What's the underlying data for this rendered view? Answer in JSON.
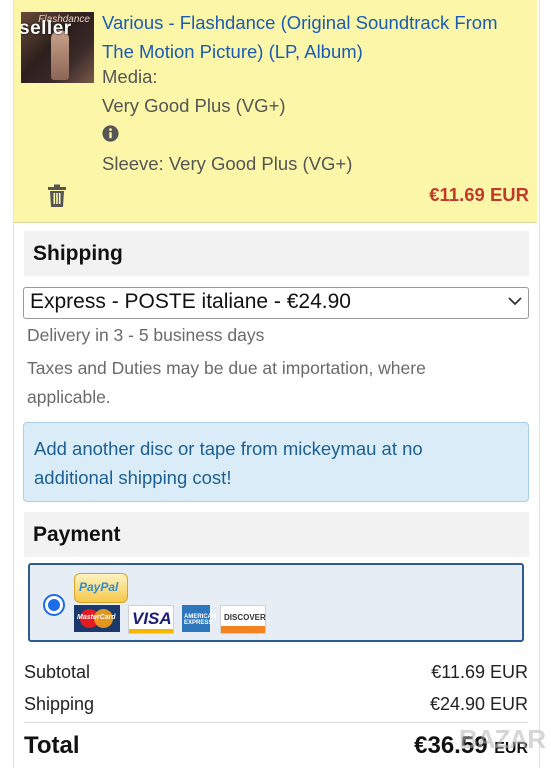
{
  "item": {
    "thumbnail_text": "seller",
    "thumbnail_script": "Flashdance",
    "title": "Various - Flashdance (Original Soundtrack From The Motion Picture) (LP, Album)",
    "media_label": "Media:",
    "media_value": "Very Good Plus (VG+)",
    "sleeve": "Sleeve: Very Good Plus (VG+)",
    "price": "€11.69 EUR",
    "icons": [
      "info-icon",
      "trash-icon"
    ]
  },
  "shipping": {
    "heading": "Shipping",
    "selected_option": "Express - POSTE italiane - €24.90",
    "delivery": "Delivery in 3 - 5 business days",
    "taxes_note": "Taxes and Duties may be due at importation, where applicable.",
    "alert": "Add another disc or tape from mickeymau at no additional shipping cost!"
  },
  "payment": {
    "heading": "Payment",
    "paypal": "PayPal",
    "cards": {
      "mastercard": "MasterCard",
      "visa": "VISA",
      "amex": "AMERICAN EXPRESS",
      "discover": "DISCOVER"
    }
  },
  "summary": {
    "subtotal_label": "Subtotal",
    "subtotal_value": "€11.69 EUR",
    "shipping_label": "Shipping",
    "shipping_value": "€24.90 EUR",
    "total_label": "Total",
    "total_value": "€36.59",
    "total_currency": "EUR"
  },
  "watermark": "BAZAR",
  "colors": {
    "item_bg": "#fcf7a8",
    "link": "#1a5bb5",
    "price": "#c0392b",
    "alert_bg": "#d9ecf8",
    "alert_text": "#1d5f94",
    "payment_border": "#2f5c8f"
  }
}
